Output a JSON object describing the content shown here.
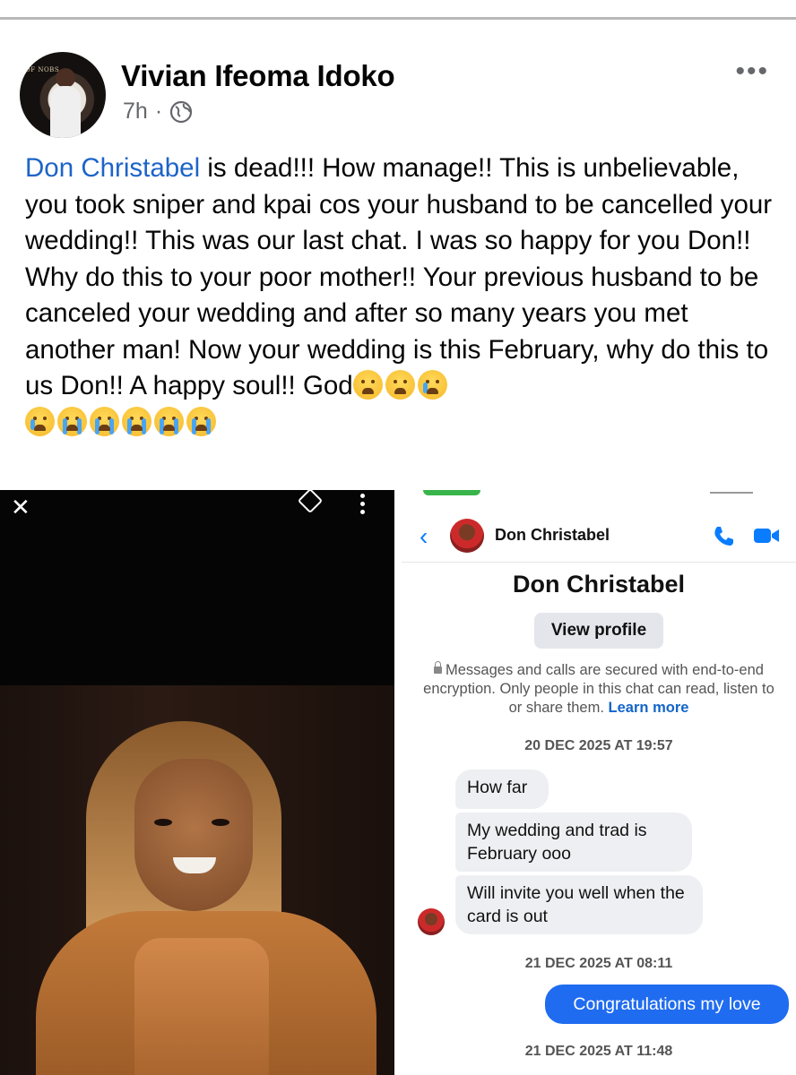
{
  "post": {
    "author": "Vivian Ifeoma Idoko",
    "time": "7h",
    "separator": "·",
    "mention": "Don Christabel",
    "body": " is dead!!! How manage!! This is unbelievable, you took sniper and kpai cos your husband to be cancelled your wedding!! This was our last chat. I was so happy for you Don!! Why do this to your poor mother!! Your previous husband to be canceled your wedding and after so many years you met another man! Now your wedding is this February, why do this to us Don!! A happy soul!! God",
    "more_label": "•••",
    "emojis": [
      "weary-face",
      "weary-face",
      "crying-face",
      "crying-face",
      "sob-face",
      "sob-face",
      "sob-face",
      "sob-face",
      "sob-face"
    ],
    "avatar_sign_text": "OF NOBS"
  },
  "photo": {
    "close_label": "✕"
  },
  "chat": {
    "header_name": "Don Christabel",
    "title_name": "Don Christabel",
    "view_profile": "View profile",
    "secure_text": "Messages and calls are secured with end-to-end encryption. Only people in this chat can read, listen to or share them.",
    "learn_more": "Learn more",
    "timestamp_1": "20 DEC 2025 AT 19:57",
    "timestamp_2": "21 DEC 2025 AT 08:11",
    "timestamp_3": "21 DEC 2025 AT 11:48",
    "messages_in": [
      "How far",
      "My wedding and trad is February ooo",
      "Will invite you well when the card is out"
    ],
    "message_out": "Congratulations my love",
    "back_label": "‹"
  },
  "colors": {
    "link_blue": "#1d64c8",
    "messenger_blue": "#1f6cf0",
    "meta_gray": "#65676b"
  }
}
